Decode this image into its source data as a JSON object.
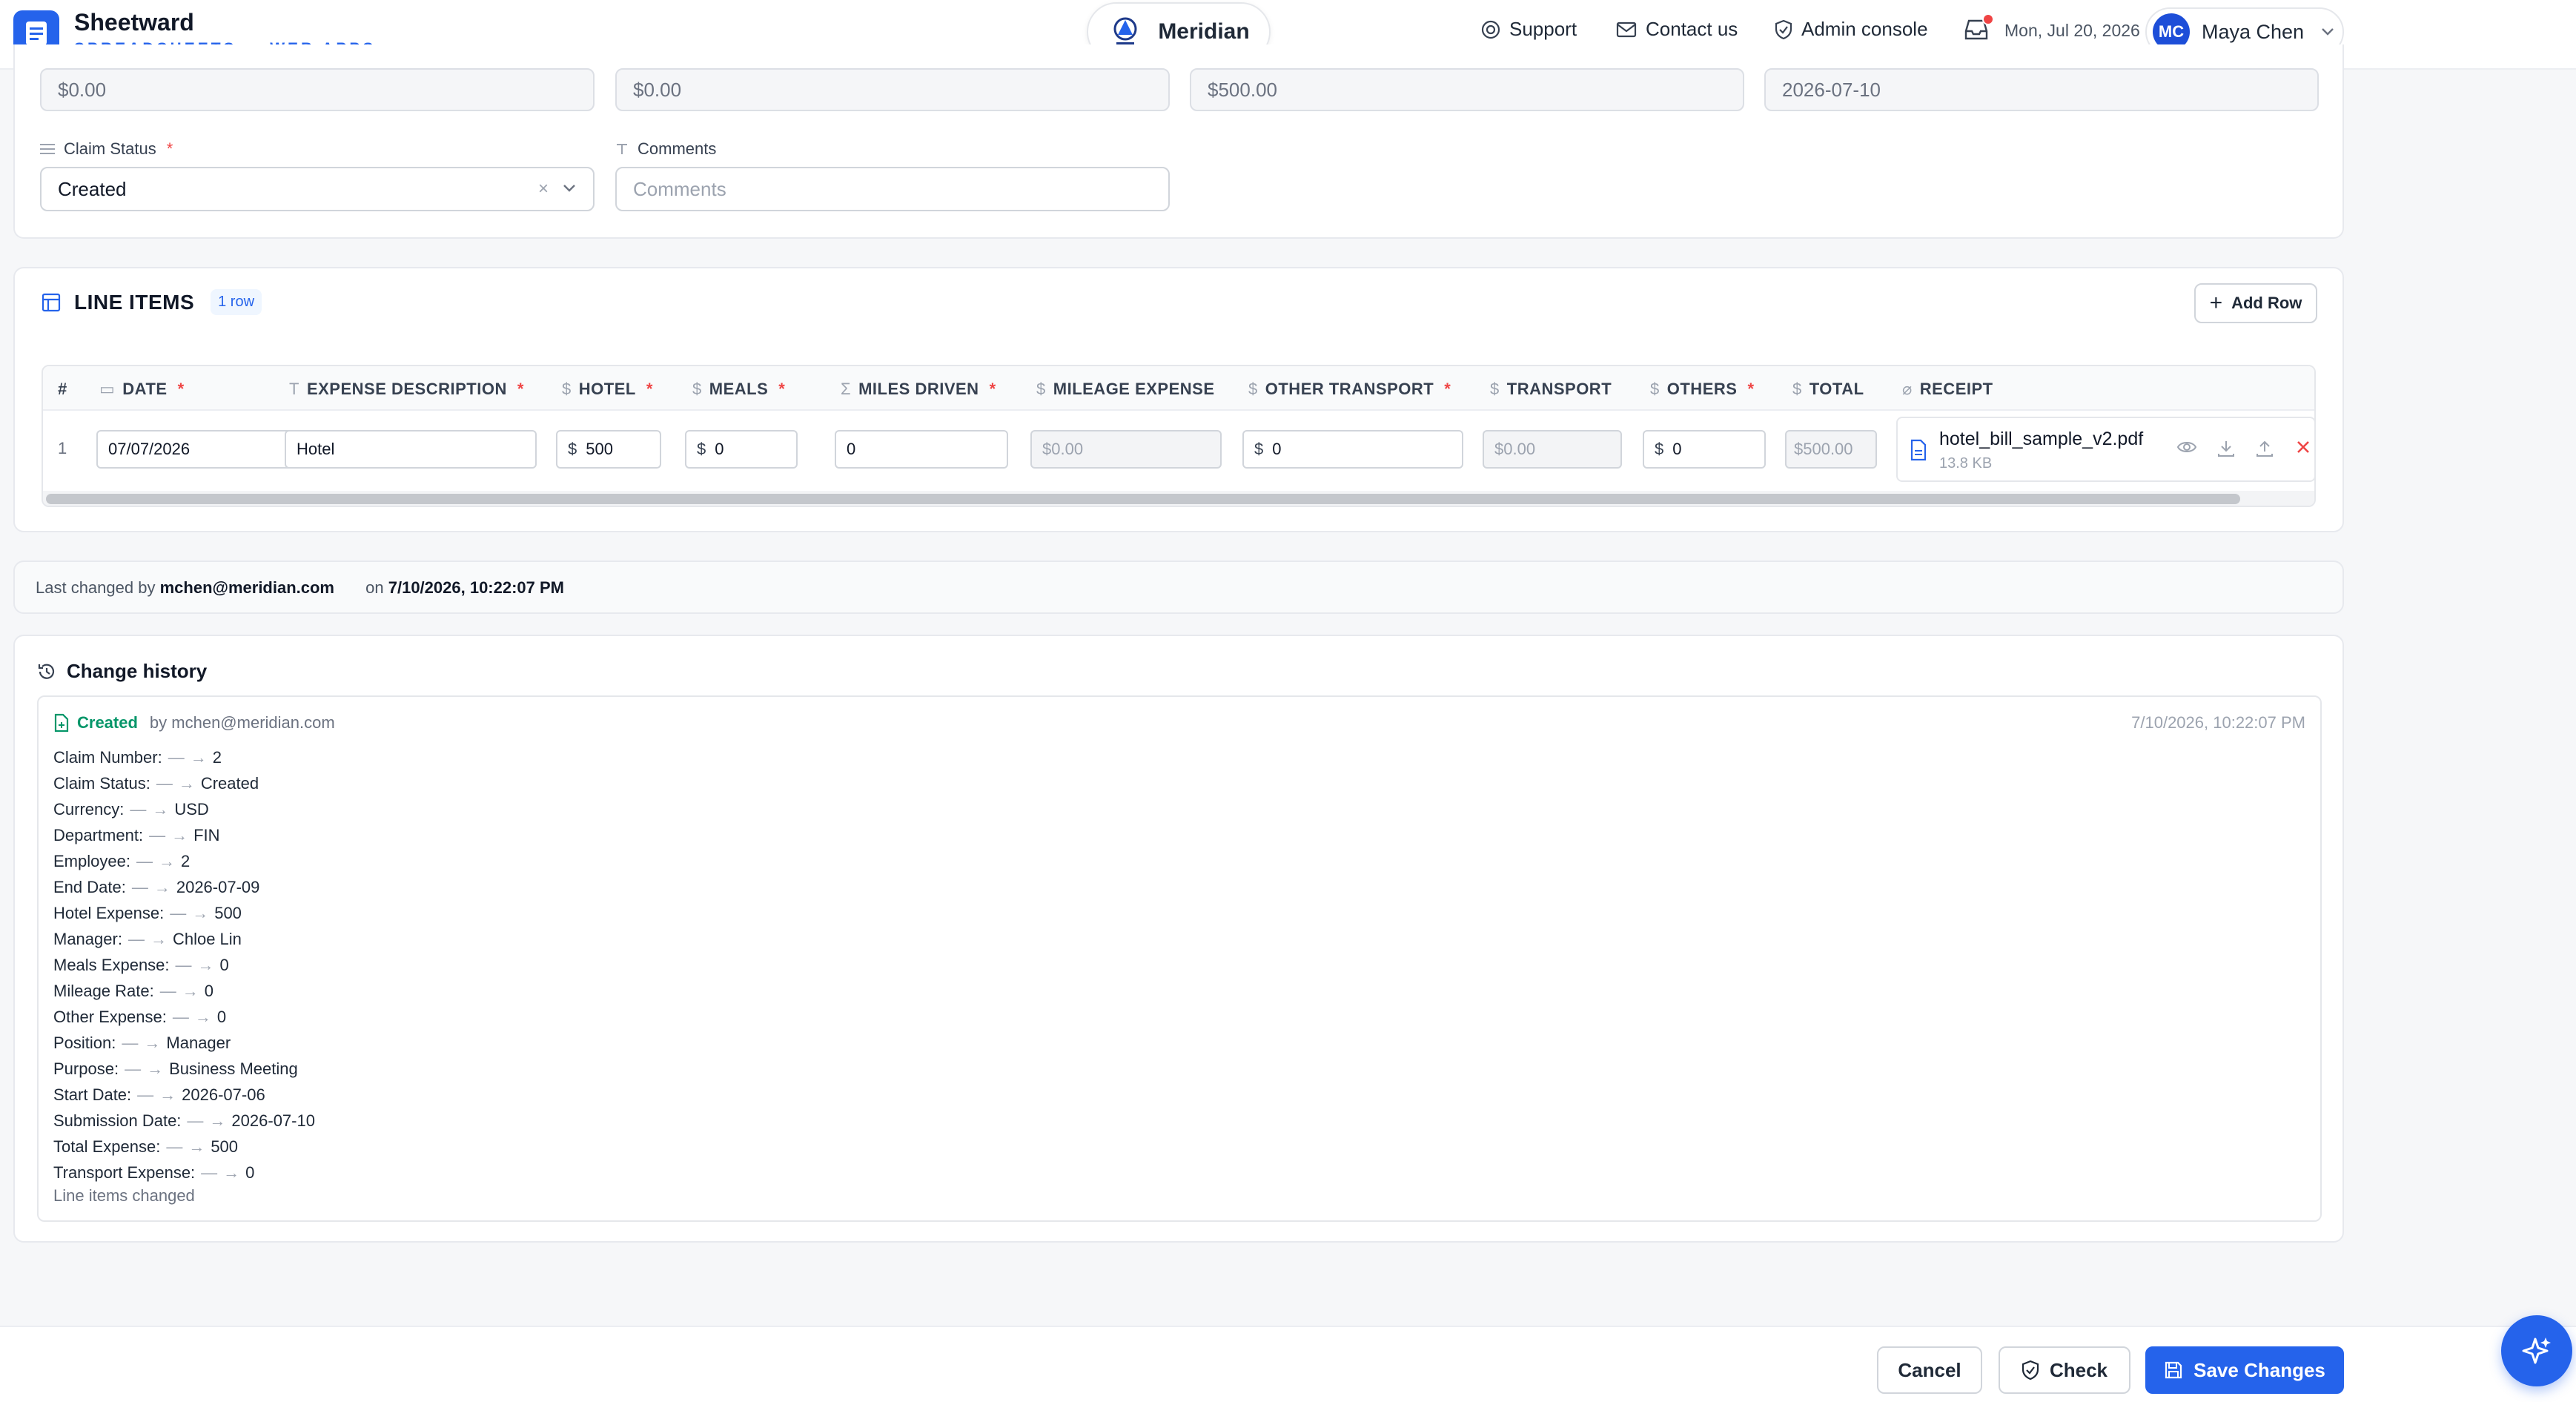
{
  "header": {
    "brand_name": "Sheetward",
    "brand_sub": "SPREADSHEETS → WEB APPS",
    "org_name": "Meridian",
    "nav": {
      "support": "Support",
      "contact": "Contact us",
      "admin": "Admin console"
    },
    "date": "Mon, Jul 20, 2026",
    "user_initials": "MC",
    "user_name": "Maya Chen"
  },
  "form": {
    "readonly_values": [
      "$0.00",
      "$0.00",
      "$500.00",
      "2026-07-10"
    ],
    "claim_status_label": "Claim Status",
    "claim_status_value": "Created",
    "comments_label": "Comments",
    "comments_placeholder": "Comments"
  },
  "line_items": {
    "title": "LINE ITEMS",
    "row_count": "1 row",
    "add_row_label": "Add Row",
    "columns": {
      "num": "#",
      "date": "DATE",
      "desc": "EXPENSE DESCRIPTION",
      "hotel": "HOTEL",
      "meals": "MEALS",
      "miles": "MILES DRIVEN",
      "mileage": "MILEAGE EXPENSE",
      "other_transport": "OTHER TRANSPORT",
      "transport": "TRANSPORT",
      "others": "OTHERS",
      "total": "TOTAL",
      "receipt": "RECEIPT"
    },
    "row": {
      "num": "1",
      "date": "07/07/2026",
      "desc": "Hotel",
      "hotel": "500",
      "meals": "0",
      "miles": "0",
      "mileage": "$0.00",
      "other_transport": "0",
      "transport": "$0.00",
      "others": "0",
      "total": "$500.00",
      "receipt_name": "hotel_bill_sample_v2.pdf",
      "receipt_size": "13.8 KB"
    }
  },
  "last_changed": {
    "prefix": "Last changed by",
    "user": "mchen@meridian.com",
    "on": "on",
    "time": "7/10/2026, 10:22:07 PM"
  },
  "history": {
    "title": "Change history",
    "status": "Created",
    "by": "by mchen@meridian.com",
    "time": "7/10/2026, 10:22:07 PM",
    "changes": [
      {
        "field": "Claim Number:",
        "from": "—",
        "to": "2"
      },
      {
        "field": "Claim Status:",
        "from": "—",
        "to": "Created"
      },
      {
        "field": "Currency:",
        "from": "—",
        "to": "USD"
      },
      {
        "field": "Department:",
        "from": "—",
        "to": "FIN"
      },
      {
        "field": "Employee:",
        "from": "—",
        "to": "2"
      },
      {
        "field": "End Date:",
        "from": "—",
        "to": "2026-07-09"
      },
      {
        "field": "Hotel Expense:",
        "from": "—",
        "to": "500"
      },
      {
        "field": "Manager:",
        "from": "—",
        "to": "Chloe Lin"
      },
      {
        "field": "Meals Expense:",
        "from": "—",
        "to": "0"
      },
      {
        "field": "Mileage Rate:",
        "from": "—",
        "to": "0"
      },
      {
        "field": "Other Expense:",
        "from": "—",
        "to": "0"
      },
      {
        "field": "Position:",
        "from": "—",
        "to": "Manager"
      },
      {
        "field": "Purpose:",
        "from": "—",
        "to": "Business Meeting"
      },
      {
        "field": "Start Date:",
        "from": "—",
        "to": "2026-07-06"
      },
      {
        "field": "Submission Date:",
        "from": "—",
        "to": "2026-07-10"
      },
      {
        "field": "Total Expense:",
        "from": "—",
        "to": "500"
      },
      {
        "field": "Transport Expense:",
        "from": "—",
        "to": "0"
      }
    ],
    "footer_note": "Line items changed"
  },
  "footer": {
    "cancel": "Cancel",
    "check": "Check",
    "save": "Save Changes"
  },
  "colors": {
    "accent": "#2563eb",
    "success": "#059669",
    "required": "#ef4444"
  }
}
